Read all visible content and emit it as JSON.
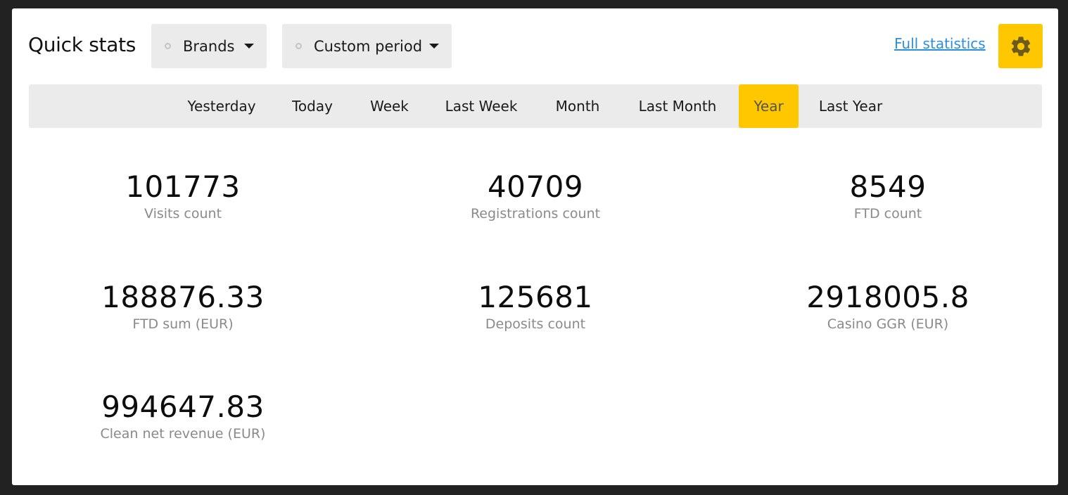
{
  "header": {
    "title": "Quick stats",
    "brands_label": "Brands",
    "period_label": "Custom period",
    "full_stats_link": "Full statistics",
    "settings_icon": "gear-icon"
  },
  "tabs": [
    {
      "label": "Yesterday",
      "active": false
    },
    {
      "label": "Today",
      "active": false
    },
    {
      "label": "Week",
      "active": false
    },
    {
      "label": "Last Week",
      "active": false
    },
    {
      "label": "Month",
      "active": false
    },
    {
      "label": "Last Month",
      "active": false
    },
    {
      "label": "Year",
      "active": true
    },
    {
      "label": "Last Year",
      "active": false
    }
  ],
  "stats": [
    {
      "value": "101773",
      "label": "Visits count"
    },
    {
      "value": "40709",
      "label": "Registrations count"
    },
    {
      "value": "8549",
      "label": "FTD count"
    },
    {
      "value": "188876.33",
      "label": "FTD sum (EUR)"
    },
    {
      "value": "125681",
      "label": "Deposits count"
    },
    {
      "value": "2918005.8",
      "label": "Casino GGR (EUR)"
    },
    {
      "value": "994647.83",
      "label": "Clean net revenue (EUR)"
    }
  ],
  "colors": {
    "accent": "#ffc700",
    "link": "#2b8fe0",
    "panel_bg": "#ebebeb",
    "page_bg": "#222222"
  }
}
